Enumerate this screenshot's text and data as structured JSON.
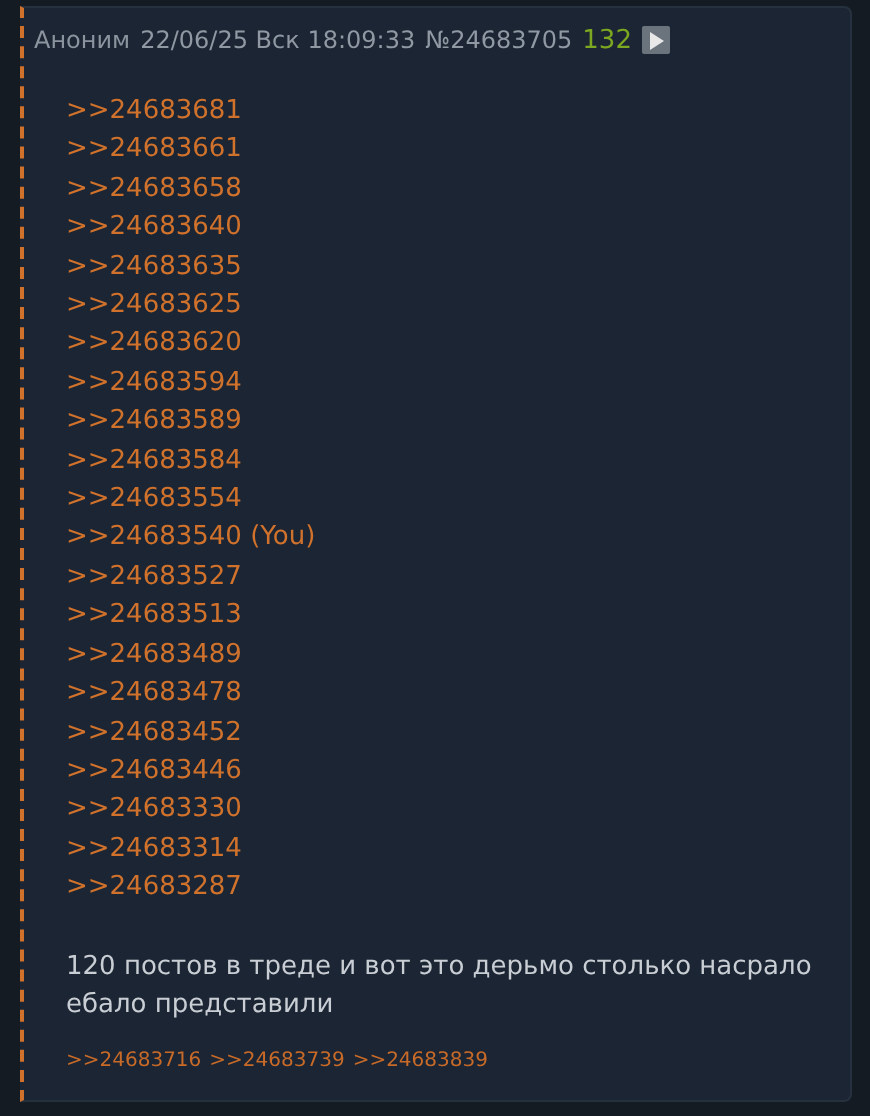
{
  "post": {
    "author": "Аноним",
    "date": "22/06/25 Вск 18:09:33",
    "number": "№24683705",
    "count": "132",
    "replies": [
      {
        "text": ">>24683681"
      },
      {
        "text": ">>24683661"
      },
      {
        "text": ">>24683658"
      },
      {
        "text": ">>24683640"
      },
      {
        "text": ">>24683635"
      },
      {
        "text": ">>24683625"
      },
      {
        "text": ">>24683620"
      },
      {
        "text": ">>24683594"
      },
      {
        "text": ">>24683589"
      },
      {
        "text": ">>24683584"
      },
      {
        "text": ">>24683554"
      },
      {
        "text": ">>24683540 (You)"
      },
      {
        "text": ">>24683527"
      },
      {
        "text": ">>24683513"
      },
      {
        "text": ">>24683489"
      },
      {
        "text": ">>24683478"
      },
      {
        "text": ">>24683452"
      },
      {
        "text": ">>24683446"
      },
      {
        "text": ">>24683330"
      },
      {
        "text": ">>24683314"
      },
      {
        "text": ">>24683287"
      }
    ],
    "message": "120 постов в треде и вот это дерьмо столько насрало ебало представили",
    "backlinks": [
      ">>24683716",
      ">>24683739",
      ">>24683839"
    ]
  }
}
